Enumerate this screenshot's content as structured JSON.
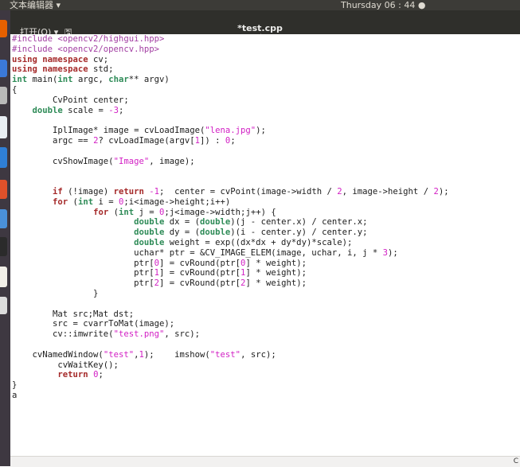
{
  "topbar": {
    "app_menu": "文本编辑器 ▾",
    "clock": "Thursday 06 : 44 ●"
  },
  "toolbar": {
    "open_label": "打开(O) ▾",
    "save_icon": "save-icon"
  },
  "document": {
    "title": "*test.cpp",
    "subtitle": "/"
  },
  "code_lines": [
    [
      {
        "c": "pp",
        "t": "#include <opencv2/highgui.hpp>"
      }
    ],
    [
      {
        "c": "pp",
        "t": "#include <opencv2/opencv.hpp>"
      }
    ],
    [
      {
        "c": "kw",
        "t": "using namespace"
      },
      {
        "t": " cv;"
      }
    ],
    [
      {
        "c": "kw",
        "t": "using namespace"
      },
      {
        "t": " std;"
      }
    ],
    [
      {
        "c": "ty",
        "t": "int"
      },
      {
        "t": " main("
      },
      {
        "c": "ty",
        "t": "int"
      },
      {
        "t": " argc, "
      },
      {
        "c": "ty",
        "t": "char"
      },
      {
        "t": "** argv)"
      }
    ],
    [
      {
        "t": "{"
      }
    ],
    [
      {
        "t": "        CvPoint center;"
      }
    ],
    [
      {
        "t": "    "
      },
      {
        "c": "ty",
        "t": "double"
      },
      {
        "t": " scale = "
      },
      {
        "c": "nm",
        "t": "-3"
      },
      {
        "t": ";"
      }
    ],
    [
      {
        "t": ""
      }
    ],
    [
      {
        "t": "        IplImage* image = cvLoadImage("
      },
      {
        "c": "st",
        "t": "\"lena.jpg\""
      },
      {
        "t": ");"
      }
    ],
    [
      {
        "t": "        argc == "
      },
      {
        "c": "nm",
        "t": "2"
      },
      {
        "t": "? cvLoadImage(argv["
      },
      {
        "c": "nm",
        "t": "1"
      },
      {
        "t": "]) : "
      },
      {
        "c": "nm",
        "t": "0"
      },
      {
        "t": ";"
      }
    ],
    [
      {
        "t": ""
      }
    ],
    [
      {
        "t": "        cvShowImage("
      },
      {
        "c": "st",
        "t": "\"Image\""
      },
      {
        "t": ", image);"
      }
    ],
    [
      {
        "t": ""
      }
    ],
    [
      {
        "t": ""
      }
    ],
    [
      {
        "t": "        "
      },
      {
        "c": "kw",
        "t": "if"
      },
      {
        "t": " (!image) "
      },
      {
        "c": "kw",
        "t": "return"
      },
      {
        "t": " "
      },
      {
        "c": "nm",
        "t": "-1"
      },
      {
        "t": ";  center = cvPoint(image->width / "
      },
      {
        "c": "nm",
        "t": "2"
      },
      {
        "t": ", image->height / "
      },
      {
        "c": "nm",
        "t": "2"
      },
      {
        "t": ");"
      }
    ],
    [
      {
        "t": "        "
      },
      {
        "c": "kw",
        "t": "for"
      },
      {
        "t": " ("
      },
      {
        "c": "ty",
        "t": "int"
      },
      {
        "t": " i = "
      },
      {
        "c": "nm",
        "t": "0"
      },
      {
        "t": ";i<image->height;i++)"
      }
    ],
    [
      {
        "t": "                "
      },
      {
        "c": "kw",
        "t": "for"
      },
      {
        "t": " ("
      },
      {
        "c": "ty",
        "t": "int"
      },
      {
        "t": " j = "
      },
      {
        "c": "nm",
        "t": "0"
      },
      {
        "t": ";j<image->width;j++) {"
      }
    ],
    [
      {
        "t": "                        "
      },
      {
        "c": "ty",
        "t": "double"
      },
      {
        "t": " dx = ("
      },
      {
        "c": "ty",
        "t": "double"
      },
      {
        "t": ")(j - center.x) / center.x;"
      }
    ],
    [
      {
        "t": "                        "
      },
      {
        "c": "ty",
        "t": "double"
      },
      {
        "t": " dy = ("
      },
      {
        "c": "ty",
        "t": "double"
      },
      {
        "t": ")(i - center.y) / center.y;"
      }
    ],
    [
      {
        "t": "                        "
      },
      {
        "c": "ty",
        "t": "double"
      },
      {
        "t": " weight = exp((dx*dx + dy*dy)*scale);"
      }
    ],
    [
      {
        "t": "                        uchar* ptr = &CV_IMAGE_ELEM(image, uchar, i, j * "
      },
      {
        "c": "nm",
        "t": "3"
      },
      {
        "t": ");"
      }
    ],
    [
      {
        "t": "                        ptr["
      },
      {
        "c": "nm",
        "t": "0"
      },
      {
        "t": "] = cvRound(ptr["
      },
      {
        "c": "nm",
        "t": "0"
      },
      {
        "t": "] * weight);"
      }
    ],
    [
      {
        "t": "                        ptr["
      },
      {
        "c": "nm",
        "t": "1"
      },
      {
        "t": "] = cvRound(ptr["
      },
      {
        "c": "nm",
        "t": "1"
      },
      {
        "t": "] * weight);"
      }
    ],
    [
      {
        "t": "                        ptr["
      },
      {
        "c": "nm",
        "t": "2"
      },
      {
        "t": "] = cvRound(ptr["
      },
      {
        "c": "nm",
        "t": "2"
      },
      {
        "t": "] * weight);"
      }
    ],
    [
      {
        "t": "                }"
      }
    ],
    [
      {
        "t": ""
      }
    ],
    [
      {
        "t": "        Mat src;Mat dst;"
      }
    ],
    [
      {
        "t": "        src = cvarrToMat(image);"
      }
    ],
    [
      {
        "t": "        cv::imwrite("
      },
      {
        "c": "st",
        "t": "\"test.png\""
      },
      {
        "t": ", src);"
      }
    ],
    [
      {
        "t": ""
      }
    ],
    [
      {
        "t": "    cvNamedWindow("
      },
      {
        "c": "st",
        "t": "\"test\""
      },
      {
        "t": ","
      },
      {
        "c": "nm",
        "t": "1"
      },
      {
        "t": ");    imshow("
      },
      {
        "c": "st",
        "t": "\"test\""
      },
      {
        "t": ", src);"
      }
    ],
    [
      {
        "t": "         cvWaitKey();"
      }
    ],
    [
      {
        "t": "         "
      },
      {
        "c": "kw",
        "t": "return"
      },
      {
        "t": " "
      },
      {
        "c": "nm",
        "t": "0"
      },
      {
        "t": ";"
      }
    ],
    [
      {
        "t": "}"
      }
    ],
    [
      {
        "t": "a"
      }
    ]
  ],
  "statusbar": {
    "text": "C"
  },
  "colors": {
    "preprocessor": "#a23ea2",
    "keyword": "#a52a2a",
    "type": "#2e8b57",
    "literal": "#d21fc4",
    "launcher": "#3e3841",
    "panel": "#3c3b37"
  },
  "launcher_icons": [
    {
      "name": "firefox-icon",
      "color": "#e66000"
    },
    {
      "name": "chromium-icon",
      "color": "#3b79d8"
    },
    {
      "name": "files-icon",
      "color": "#b9b9b9"
    },
    {
      "name": "document-icon",
      "color": "#e9eef4"
    },
    {
      "name": "writer-icon",
      "color": "#2f7fd6"
    },
    {
      "name": "software-center-icon",
      "color": "#e0512a"
    },
    {
      "name": "help-icon",
      "color": "#4a90d9"
    },
    {
      "name": "terminal-icon",
      "color": "#2b2b2b"
    },
    {
      "name": "text-editor-icon",
      "color": "#f2efe8"
    },
    {
      "name": "trash-icon",
      "color": "#dcdcdc"
    }
  ]
}
